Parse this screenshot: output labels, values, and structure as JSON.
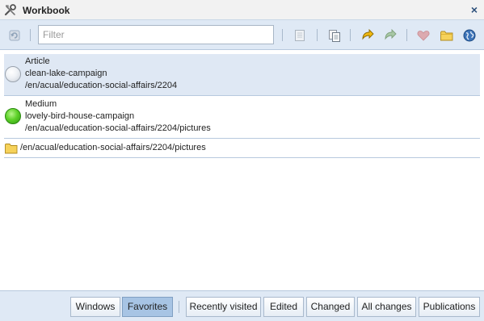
{
  "window": {
    "title": "Workbook",
    "close_symbol": "×"
  },
  "toolbar": {
    "filter_placeholder": "Filter",
    "filter_value": ""
  },
  "items": [
    {
      "type": "Article",
      "name": "clean-lake-campaign",
      "path": "/en/acual/education-social-affairs/2204",
      "status_icon": "grey-circle-icon",
      "selected": true
    },
    {
      "type": "Medium",
      "name": "lovely-bird-house-campaign",
      "path": "/en/acual/education-social-affairs/2204/pictures",
      "status_icon": "green-circle-icon",
      "selected": false
    },
    {
      "type": "folder",
      "path": "/en/acual/education-social-affairs/2204/pictures",
      "status_icon": "folder-icon"
    }
  ],
  "footer": {
    "tabs": [
      "Windows",
      "Favorites",
      "Recently visited",
      "Edited",
      "Changed",
      "All changes",
      "Publications"
    ],
    "active_tab": "Favorites"
  },
  "colors": {
    "accent": "#dfe9f5",
    "selected_row": "#dfe8f4",
    "active_tab": "#a7c4e4",
    "status_green": "#5fd22a"
  }
}
